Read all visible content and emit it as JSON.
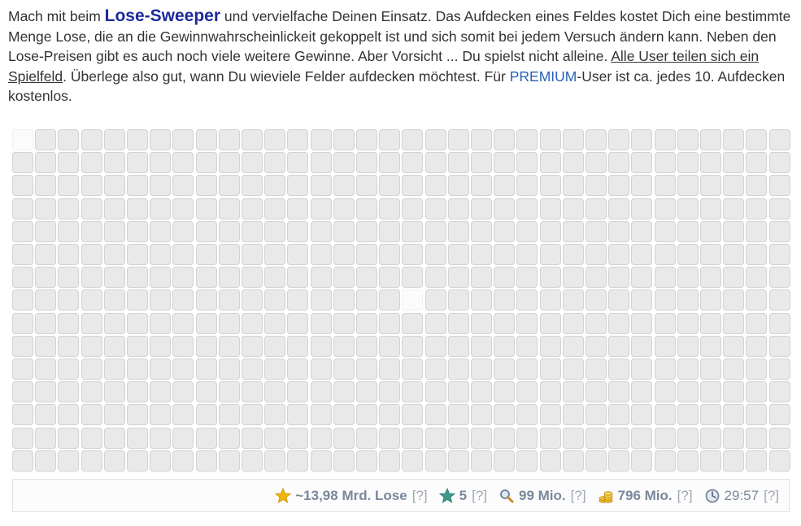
{
  "intro": {
    "t1": "Mach mit beim ",
    "brand": "Lose-Sweeper",
    "t2": " und vervielfache Deinen Einsatz. Das Aufdecken eines Feldes kostet Dich eine bestimmte Menge Lose, die an die Gewinnwahrscheinlickeit gekoppelt ist und sich somit bei jedem Versuch ändern kann. Neben den Lose-Preisen gibt es auch noch viele weitere Gewinne. Aber Vorsicht ... Du spielst nicht alleine. ",
    "shared_link": "Alle User teilen sich ein Spielfeld",
    "t3": ". Überlege also gut, wann Du wieviele Felder aufdecken möchtest. Für ",
    "premium_link": "PREMIUM",
    "t4": "-User ist ca. jedes 10. Aufdecken kostenlos."
  },
  "board": {
    "columns": 34,
    "rows": 15,
    "revealed_cells": [
      [
        0,
        0
      ],
      [
        7,
        17
      ]
    ]
  },
  "status": {
    "lose": {
      "value": "~13,98 Mrd. Lose",
      "help": "[?]",
      "icon": "gold-star-icon"
    },
    "stars": {
      "value": "5",
      "help": "[?]",
      "icon": "green-star-icon"
    },
    "searches": {
      "value": "99 Mio.",
      "help": "[?]",
      "icon": "magnifier-icon"
    },
    "coins": {
      "value": "796 Mio.",
      "help": "[?]",
      "icon": "coin-stack-icon"
    },
    "timer": {
      "value": "29:57",
      "help": "[?]",
      "icon": "clock-icon"
    }
  },
  "colors": {
    "brand": "#1c2a9c",
    "premium_link": "#2a63b5",
    "cell_hidden": "#e9e9e9",
    "cell_revealed": "#fbfbfb",
    "status_text": "#7a889c"
  }
}
